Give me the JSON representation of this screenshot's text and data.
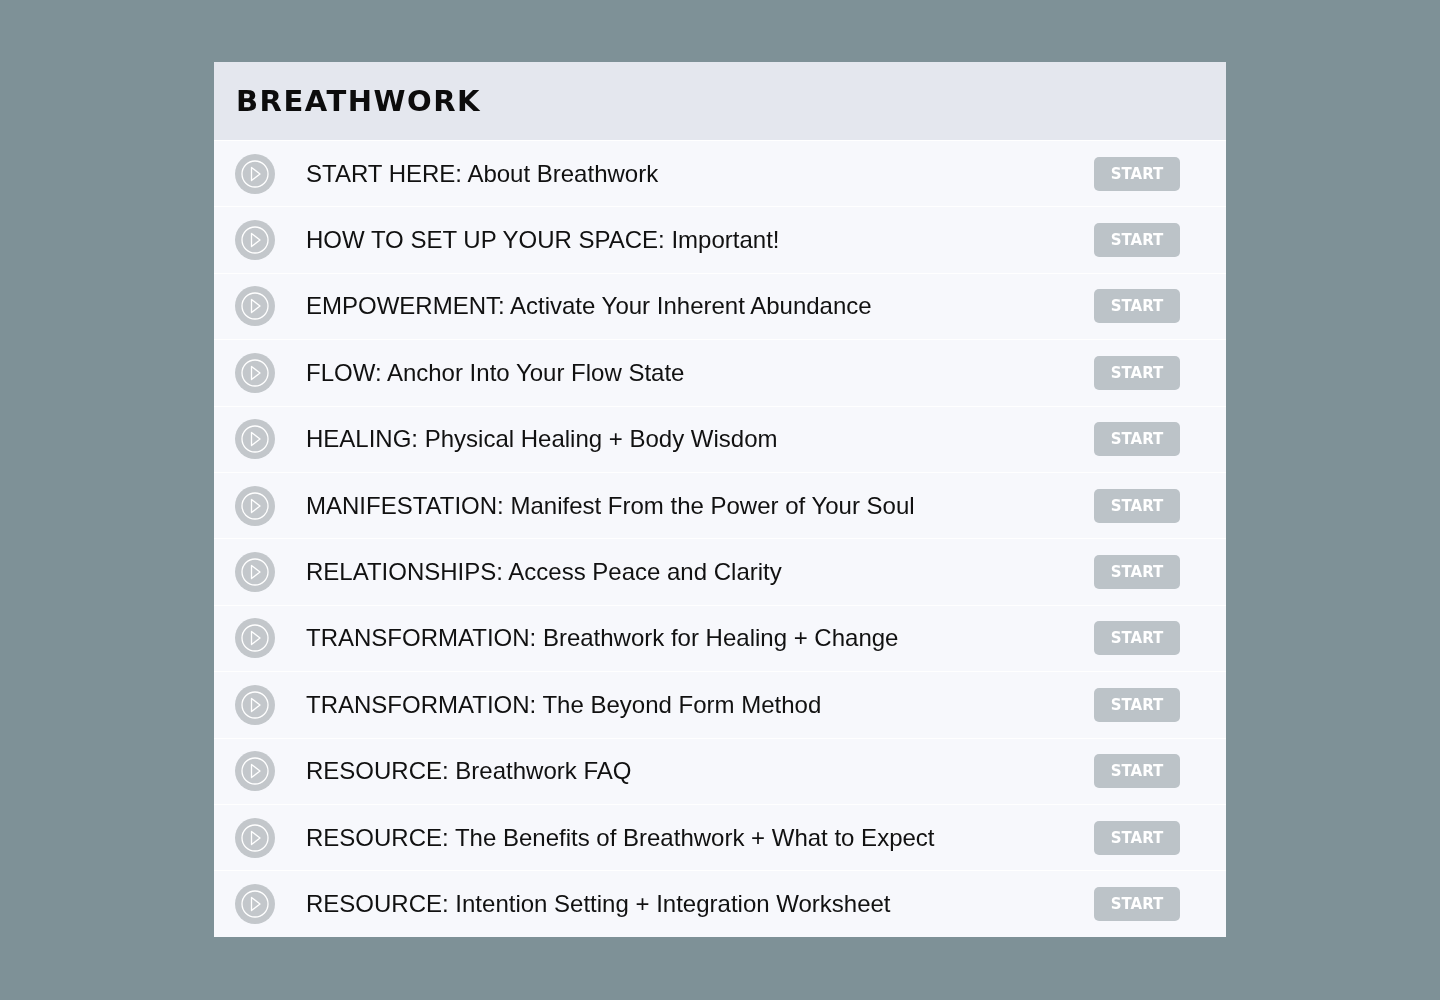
{
  "title": "BREATHWORK",
  "lessons": [
    {
      "title": "START HERE: About Breathwork",
      "button": "START"
    },
    {
      "title": "HOW TO SET UP YOUR SPACE: Important!",
      "button": "START"
    },
    {
      "title": "EMPOWERMENT: Activate Your Inherent Abundance",
      "button": "START"
    },
    {
      "title": "FLOW: Anchor Into Your Flow State",
      "button": "START"
    },
    {
      "title": "HEALING: Physical Healing + Body Wisdom",
      "button": "START"
    },
    {
      "title": "MANIFESTATION: Manifest From the Power of Your Soul",
      "button": "START"
    },
    {
      "title": "RELATIONSHIPS: Access Peace and Clarity",
      "button": "START"
    },
    {
      "title": "TRANSFORMATION: Breathwork for Healing + Change",
      "button": "START"
    },
    {
      "title": "TRANSFORMATION: The Beyond Form Method",
      "button": "START"
    },
    {
      "title": "RESOURCE: Breathwork FAQ",
      "button": "START"
    },
    {
      "title": "RESOURCE: The Benefits of Breathwork + What to Expect",
      "button": "START"
    },
    {
      "title": "RESOURCE: Intention Setting + Integration Worksheet",
      "button": "START"
    }
  ]
}
